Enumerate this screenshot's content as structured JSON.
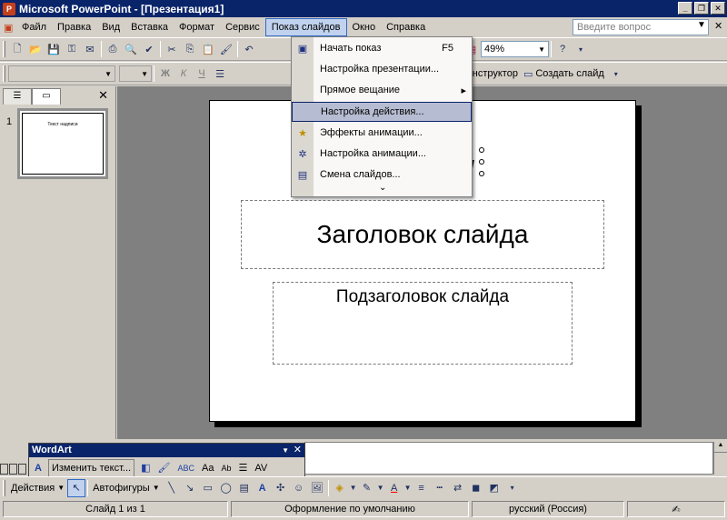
{
  "title_bar": {
    "title": "Microsoft PowerPoint - [Презентация1]",
    "icon": "powerpoint-app-icon",
    "buttons": [
      "minimize-icon",
      "restore-icon",
      "close-icon"
    ]
  },
  "menu": {
    "items": [
      "Файл",
      "Правка",
      "Вид",
      "Вставка",
      "Формат",
      "Сервис",
      "Показ слайдов",
      "Окно",
      "Справка"
    ],
    "active_index": 6,
    "ask_placeholder": "Введите вопрос"
  },
  "standard_toolbar": {
    "zoom": "49%"
  },
  "formatting_toolbar": {
    "font_name": "",
    "font_size": "",
    "bold": "Ж",
    "italic": "К",
    "underline": "Ч",
    "designer_label": "Конструктор",
    "new_slide_label": "Создать слайд"
  },
  "slide_show_menu": {
    "items": [
      {
        "icon": "slideshow-icon",
        "label": "Начать показ",
        "shortcut": "F5"
      },
      {
        "icon": "",
        "label": "Настройка презентации...",
        "shortcut": ""
      },
      {
        "icon": "",
        "label": "Прямое вещание",
        "shortcut": "▸"
      },
      {
        "icon": "",
        "label": "Настройка действия...",
        "shortcut": ""
      },
      {
        "icon": "animation-effects-icon",
        "label": "Эффекты анимации...",
        "shortcut": ""
      },
      {
        "icon": "custom-animation-icon",
        "label": "Настройка анимации...",
        "shortcut": ""
      },
      {
        "icon": "slide-transition-icon",
        "label": "Смена слайдов...",
        "shortcut": ""
      }
    ],
    "highlighted_index": 3,
    "more_label": "⌄"
  },
  "slides_panel": {
    "tabs": [
      "outline-tab-icon",
      "slides-tab-icon"
    ],
    "slide_number": "1",
    "thumbnail_title": "Текст надписи"
  },
  "slide": {
    "title": "Заголовок слайда",
    "subtitle": "Подзаголовок слайда"
  },
  "wordart_toolbar": {
    "title": "WordArt",
    "edit_text_label": "Изменить текст...",
    "letter_height": "Aa",
    "vertical": "Ab",
    "spacing": "AV",
    "abc": "ABC"
  },
  "drawing_toolbar": {
    "actions_label": "Действия",
    "autoshapes_label": "Автофигуры"
  },
  "status_bar": {
    "slide": "Слайд 1 из 1",
    "design": "Оформление по умолчанию",
    "language": "русский (Россия)"
  }
}
